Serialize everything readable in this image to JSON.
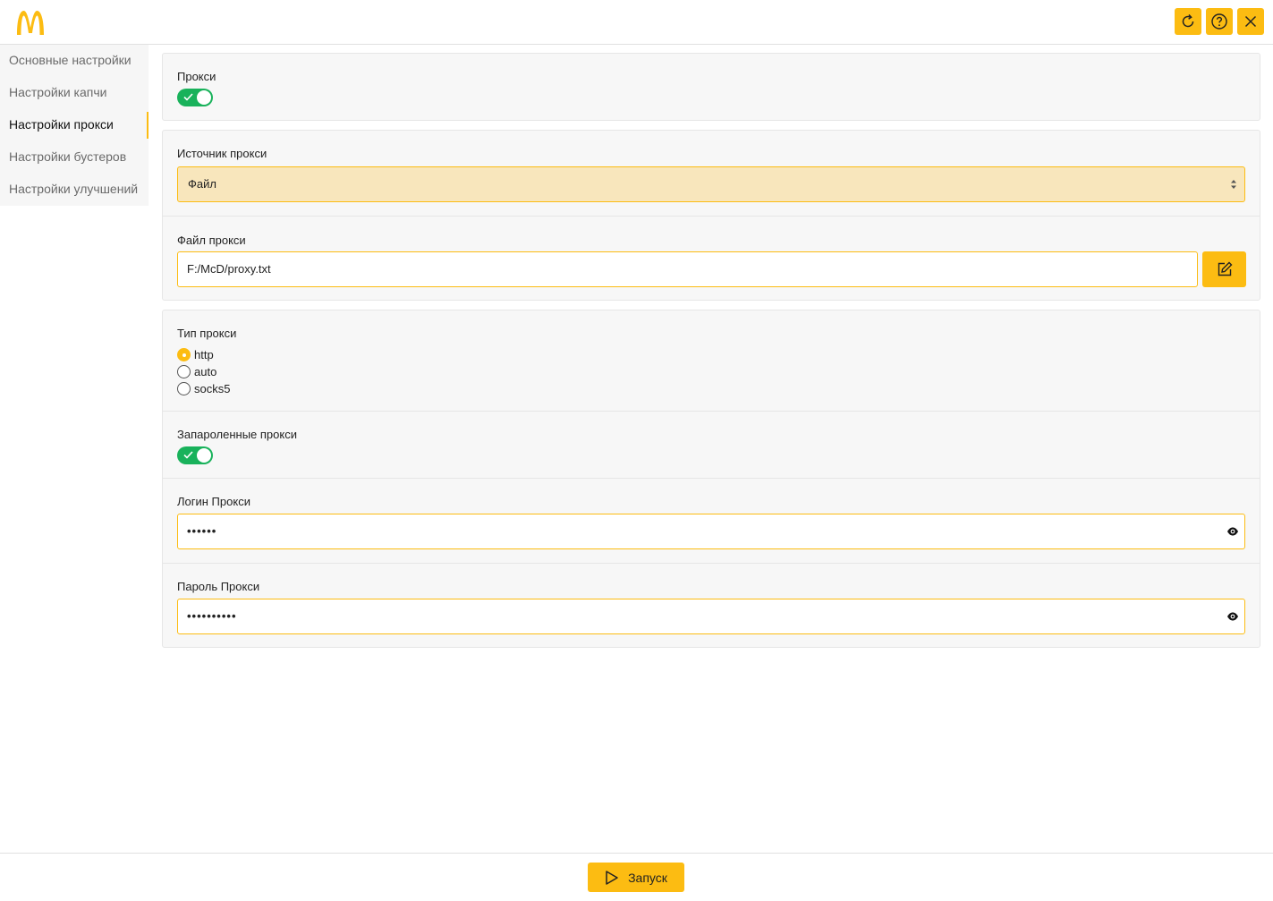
{
  "app": {
    "logo_icon": "mcdonalds-logo",
    "accent_color": "#fcbc12",
    "toggle_color": "#19b25b"
  },
  "header": {
    "buttons": [
      {
        "icon": "refresh-icon"
      },
      {
        "icon": "help-icon"
      },
      {
        "icon": "close-icon"
      }
    ]
  },
  "sidebar": {
    "items": [
      {
        "label": "Основные настройки",
        "active": false
      },
      {
        "label": "Настройки капчи",
        "active": false
      },
      {
        "label": "Настройки прокси",
        "active": true
      },
      {
        "label": "Настройки бустеров",
        "active": false
      },
      {
        "label": "Настройки улучшений",
        "active": false
      }
    ]
  },
  "proxy": {
    "label": "Прокси",
    "enabled": true
  },
  "source": {
    "label": "Источник прокси",
    "value": "Файл"
  },
  "file": {
    "label": "Файл прокси",
    "value": "F:/McD/proxy.txt",
    "edit_icon": "edit-icon"
  },
  "type": {
    "label": "Тип прокси",
    "options": [
      "http",
      "auto",
      "socks5"
    ],
    "selected": "http"
  },
  "auth": {
    "label": "Запароленные прокси",
    "enabled": true
  },
  "login": {
    "label": "Логин Прокси",
    "value": "••••••"
  },
  "password": {
    "label": "Пароль Прокси",
    "value": "••••••••••"
  },
  "footer": {
    "run_label": "Запуск",
    "run_icon": "play-icon"
  }
}
